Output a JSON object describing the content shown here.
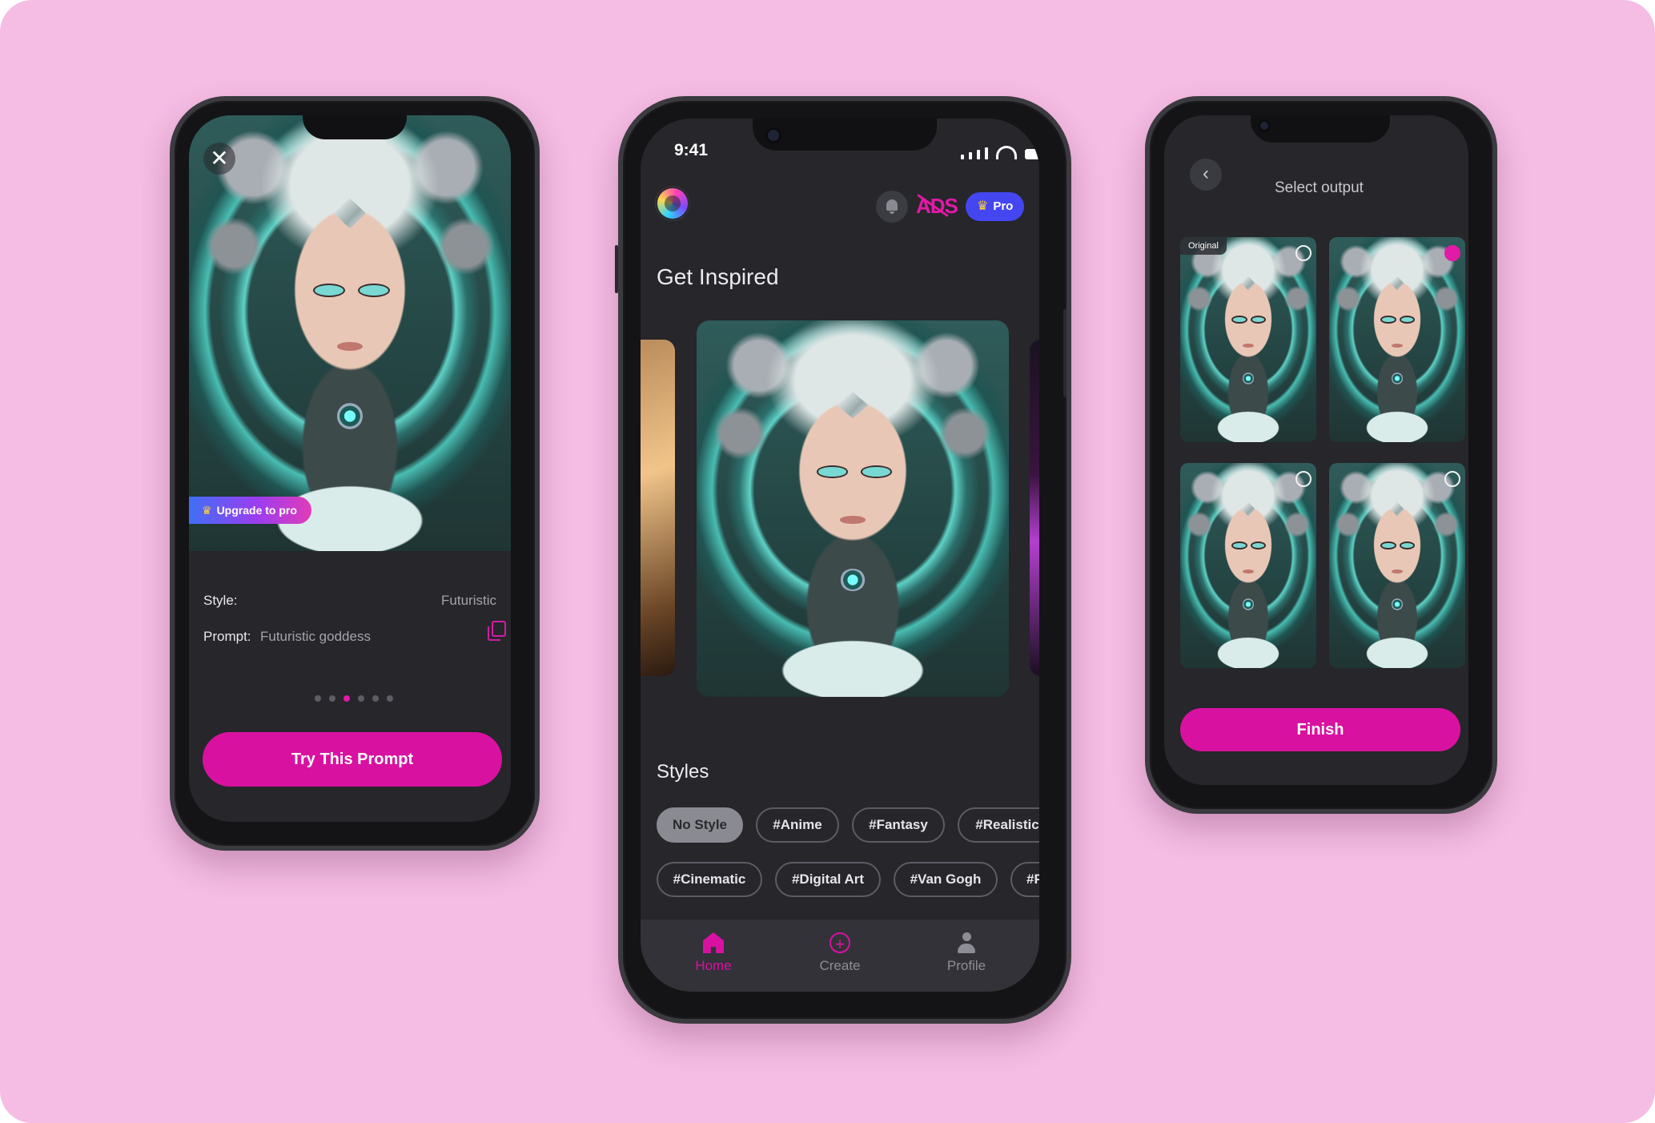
{
  "left_phone": {
    "upgrade_label": "Upgrade to pro",
    "style_label": "Style:",
    "style_value": "Futuristic",
    "prompt_label": "Prompt:",
    "prompt_value": "Futuristic goddess",
    "carousel_dots": 6,
    "carousel_active_index": 2,
    "cta_label": "Try This Prompt",
    "close_glyph": "✕"
  },
  "middle_phone": {
    "status_time": "9:41",
    "ads_label": "ADS",
    "pro_label": "Pro",
    "inspired_title": "Get Inspired",
    "styles_title": "Styles",
    "chips_row1": [
      "No Style",
      "#Anime",
      "#Fantasy",
      "#Realistic"
    ],
    "chips_row2": [
      "#Cinematic",
      "#Digital Art",
      "#Van Gogh",
      "#P"
    ],
    "selected_chip": "No Style",
    "tabs": [
      {
        "label": "Home",
        "icon": "home-icon",
        "active": true
      },
      {
        "label": "Create",
        "icon": "plus-circle-icon",
        "active": false
      },
      {
        "label": "Profile",
        "icon": "person-icon",
        "active": false
      }
    ]
  },
  "right_phone": {
    "title": "Select output",
    "original_badge": "Original",
    "selected_tile_index": 1,
    "finish_label": "Finish",
    "back_glyph": "‹"
  },
  "colors": {
    "background": "#f5bce4",
    "screen": "#26262b",
    "accent": "#d911a0",
    "pro_blue": "#4447f0"
  }
}
